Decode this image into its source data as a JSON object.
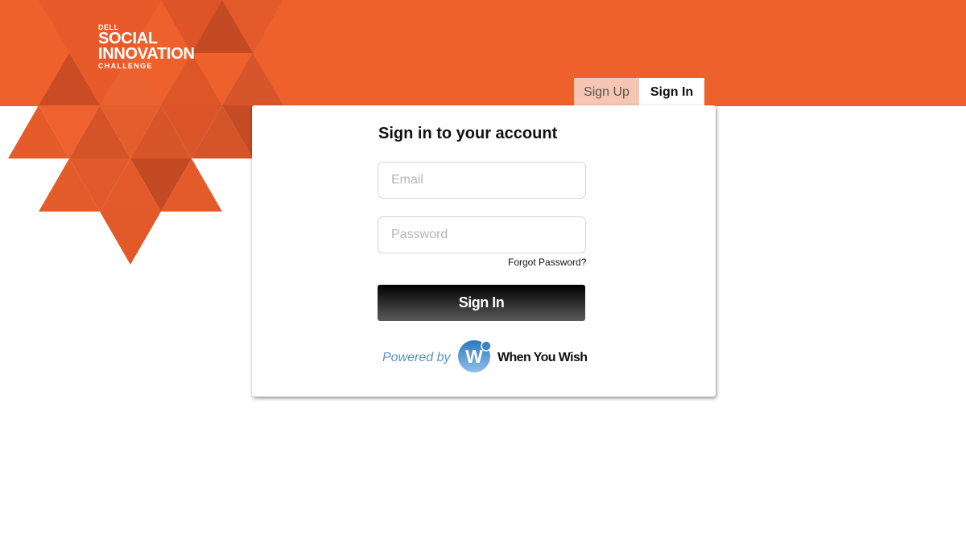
{
  "brand": {
    "line1": "DELL",
    "line2": "SOCIAL",
    "line3": "INNOVATION",
    "line4": "CHALLENGE"
  },
  "tabs": [
    {
      "label": "Sign Up",
      "active": false
    },
    {
      "label": "Sign In",
      "active": true
    }
  ],
  "form": {
    "title": "Sign in to your account",
    "email_placeholder": "Email",
    "email_value": "",
    "password_placeholder": "Password",
    "password_value": "",
    "forgot_label": "Forgot Password?",
    "submit_label": "Sign In"
  },
  "footer": {
    "powered_by": "Powered by",
    "partner_badge_letter": "W",
    "partner_name": "When You Wish"
  },
  "colors": {
    "accent_orange": "#ef612c",
    "tab_inactive": "#f7c6b2",
    "powered_blue": "#5b8fca",
    "badge_blue": "#3a86c8"
  },
  "icons": {
    "partner_logo": "when-you-wish-badge-icon"
  }
}
